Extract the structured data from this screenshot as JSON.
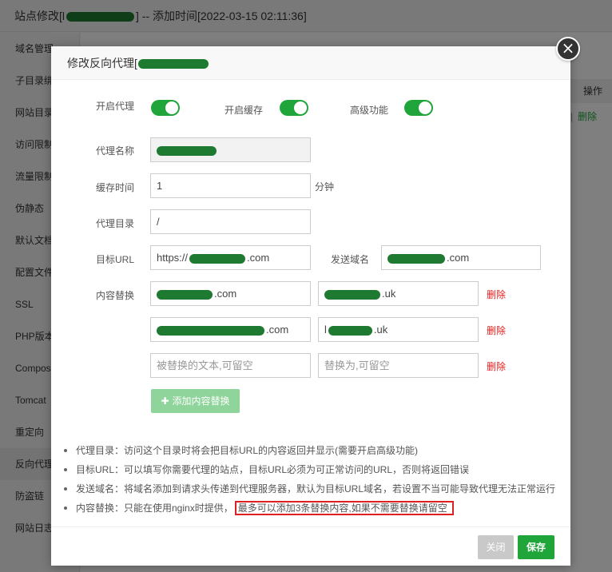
{
  "background": {
    "title_suffix": "] -- 添加时间[2022-03-15 02:11:36]",
    "title_prefix": "站点修改[l",
    "sidebar": [
      "域名管理",
      "子目录绑定",
      "网站目录",
      "访问限制",
      "流量限制",
      "伪静态",
      "默认文档",
      "配置文件",
      "SSL",
      "PHP版本",
      "Composer",
      "Tomcat",
      "重定向",
      "反向代理",
      "防盗链",
      "网站日志"
    ],
    "table_header": "操作",
    "row_action": "删除"
  },
  "dialog": {
    "title": "修改反向代理[",
    "close_icon": "×",
    "toggles": {
      "enable_proxy": "开启代理",
      "enable_cache": "开启缓存",
      "advanced": "高级功能"
    },
    "fields": {
      "proxy_name_label": "代理名称",
      "cache_time_label": "缓存时间",
      "cache_time_value": "1",
      "cache_time_unit": "分钟",
      "proxy_dir_label": "代理目录",
      "proxy_dir_value": "/",
      "target_url_label": "目标URL",
      "target_url_prefix": "https://",
      "target_url_suffix": ".com",
      "send_domain_label": "发送域名",
      "send_domain_suffix": ".com",
      "content_replace_label": "内容替换"
    },
    "replacements": [
      {
        "from_suffix": ".com",
        "to_suffix": ".uk",
        "delete": "删除"
      },
      {
        "from_suffix": ".com",
        "to_prefix": "l",
        "to_suffix": ".uk",
        "delete": "删除"
      },
      {
        "from_placeholder": "被替换的文本,可留空",
        "to_placeholder": "替换为,可留空",
        "delete": "删除"
      }
    ],
    "add_button": "添加内容替换",
    "notes": [
      "代理目录：访问这个目录时将会把目标URL的内容返回并显示(需要开启高级功能)",
      "目标URL：可以填写你需要代理的站点，目标URL必须为可正常访问的URL，否则将返回错误",
      "发送域名：将域名添加到请求头传递到代理服务器，默认为目标URL域名，若设置不当可能导致代理无法正常运行"
    ],
    "note4_prefix": "内容替换：只能在使用nginx时提供，",
    "note4_highlight": "最多可以添加3条替换内容,如果不需要替换请留空",
    "buttons": {
      "close": "关闭",
      "save": "保存"
    }
  },
  "colors": {
    "accent": "#20a53a",
    "danger": "#e02020"
  }
}
